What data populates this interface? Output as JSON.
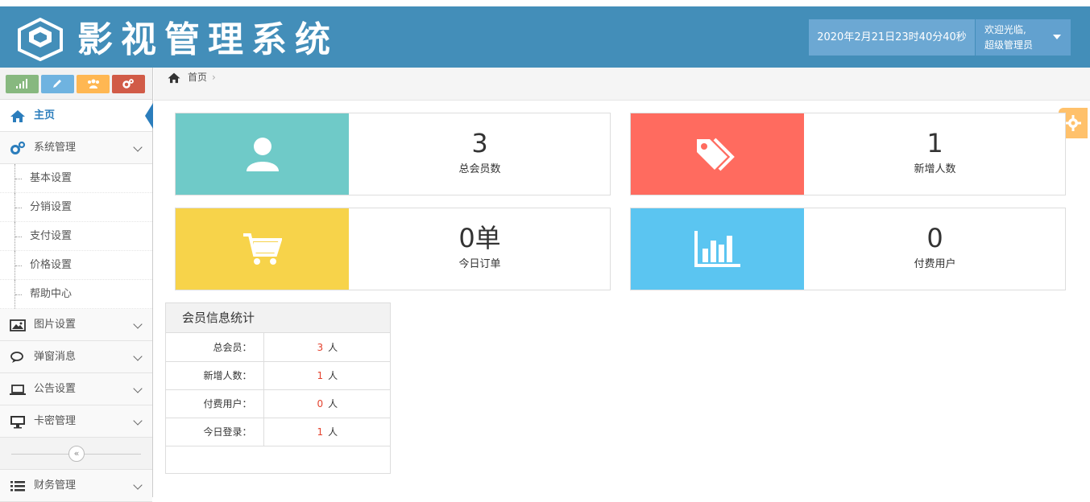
{
  "header": {
    "logo_text": "影视管理系统",
    "datetime": "2020年2月21日23时40分40秒",
    "welcome": "欢迎光临,",
    "username": "超级管理员"
  },
  "shortcuts": [
    {
      "name": "signal",
      "color": "#87b87f"
    },
    {
      "name": "pencil",
      "color": "#6fb3e0"
    },
    {
      "name": "users",
      "color": "#ffb752"
    },
    {
      "name": "cogs",
      "color": "#d15b47"
    }
  ],
  "sidebar": {
    "home": "主页",
    "system": "系统管理",
    "sub_items": [
      "基本设置",
      "分销设置",
      "支付设置",
      "价格设置",
      "帮助中心"
    ],
    "items": [
      "图片设置",
      "弹窗消息",
      "公告设置",
      "卡密管理"
    ],
    "finance": "财务管理",
    "collapse_glyph": "«"
  },
  "breadcrumb": {
    "home": "首页",
    "sep": "›"
  },
  "cards": [
    {
      "value": "3",
      "label": "总会员数",
      "color": "#6fcac8",
      "icon": "user-icon"
    },
    {
      "value": "1",
      "label": "新增人数",
      "color": "#ff6b5f",
      "icon": "tags-icon"
    },
    {
      "value": "0单",
      "label": "今日订单",
      "color": "#f7d34a",
      "icon": "cart-icon"
    },
    {
      "value": "0",
      "label": "付费用户",
      "color": "#5bc5f1",
      "icon": "bar-chart-icon"
    }
  ],
  "stats": {
    "title": "会员信息统计",
    "unit": "人",
    "rows": [
      {
        "key": "总会员：",
        "value": "3"
      },
      {
        "key": "新增人数：",
        "value": "1"
      },
      {
        "key": "付费用户：",
        "value": "0"
      },
      {
        "key": "今日登录：",
        "value": "1"
      }
    ]
  }
}
